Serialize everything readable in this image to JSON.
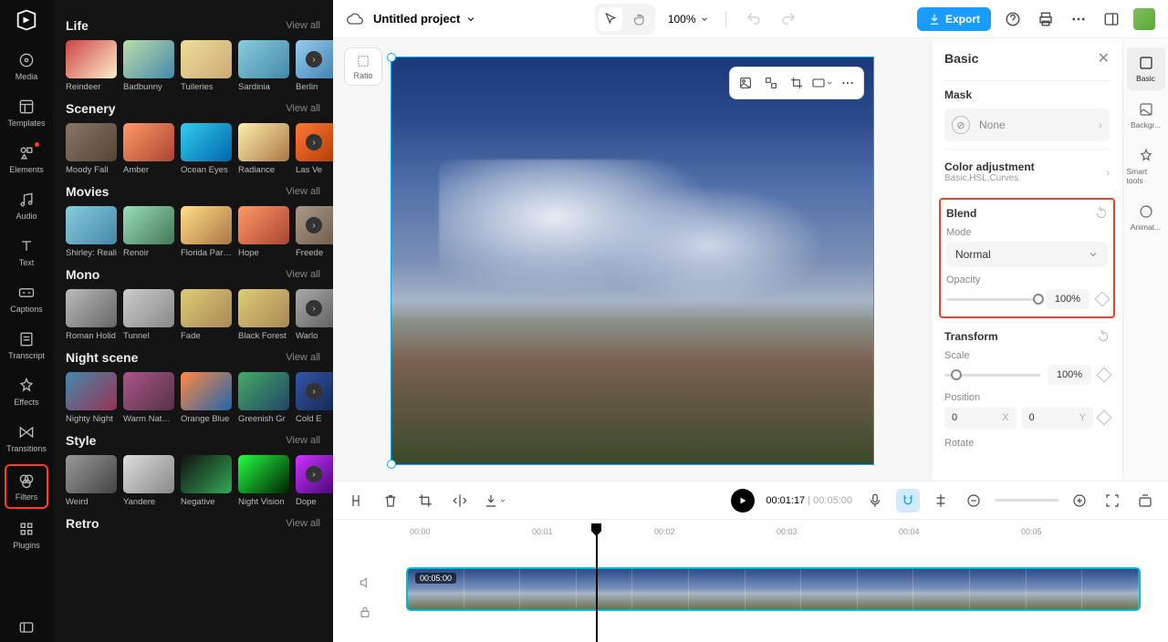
{
  "nav": {
    "items": [
      {
        "label": "Media"
      },
      {
        "label": "Templates"
      },
      {
        "label": "Elements"
      },
      {
        "label": "Audio"
      },
      {
        "label": "Text"
      },
      {
        "label": "Captions"
      },
      {
        "label": "Transcript"
      },
      {
        "label": "Effects"
      },
      {
        "label": "Transitions"
      },
      {
        "label": "Filters"
      },
      {
        "label": "Plugins"
      }
    ]
  },
  "filters": {
    "categories": [
      {
        "title": "Life",
        "view_all": "View all",
        "items": [
          "Reindeer",
          "Badbunny",
          "Tuileries",
          "Sardinia",
          "Berlin"
        ]
      },
      {
        "title": "Scenery",
        "view_all": "View all",
        "items": [
          "Moody Fall",
          "Amber",
          "Ocean Eyes",
          "Radiance",
          "Las Ve"
        ]
      },
      {
        "title": "Movies",
        "view_all": "View all",
        "items": [
          "Shirley: Reali",
          "Renoir",
          "Florida Parad",
          "Hope",
          "Freede"
        ]
      },
      {
        "title": "Mono",
        "view_all": "View all",
        "items": [
          "Roman Holid",
          "Tunnel",
          "Fade",
          "Black Forest",
          "Warlo"
        ]
      },
      {
        "title": "Night scene",
        "view_all": "View all",
        "items": [
          "Nighty Night",
          "Warm Nature",
          "Orange Blue",
          "Greenish Gr",
          "Cold E"
        ]
      },
      {
        "title": "Style",
        "view_all": "View all",
        "items": [
          "Weird",
          "Yandere",
          "Negative",
          "Night Vision",
          "Dope"
        ]
      },
      {
        "title": "Retro",
        "view_all": "View all",
        "items": []
      }
    ]
  },
  "topbar": {
    "project_title": "Untitled project",
    "zoom": "100%",
    "export": "Export"
  },
  "canvas": {
    "ratio_label": "Ratio"
  },
  "right_rail": {
    "items": [
      "Basic",
      "Backgr...",
      "Smart tools",
      "Animat..."
    ]
  },
  "props": {
    "title": "Basic",
    "mask": {
      "label": "Mask",
      "value": "None"
    },
    "color_adj": {
      "label": "Color adjustment",
      "sub": "Basic,HSL,Curves"
    },
    "blend": {
      "label": "Blend",
      "mode_label": "Mode",
      "mode_value": "Normal",
      "opacity_label": "Opacity",
      "opacity_value": "100%"
    },
    "transform": {
      "label": "Transform",
      "scale_label": "Scale",
      "scale_value": "100%",
      "position_label": "Position",
      "pos_x": "0",
      "pos_x_suffix": "X",
      "pos_y": "0",
      "pos_y_suffix": "Y",
      "rotate_label": "Rotate"
    }
  },
  "timeline": {
    "current": "00:01:17",
    "duration": "00:05:00",
    "clip_duration": "00:05:00",
    "ticks": [
      "00:00",
      "00:01",
      "00:02",
      "00:03",
      "00:04",
      "00:05"
    ]
  }
}
